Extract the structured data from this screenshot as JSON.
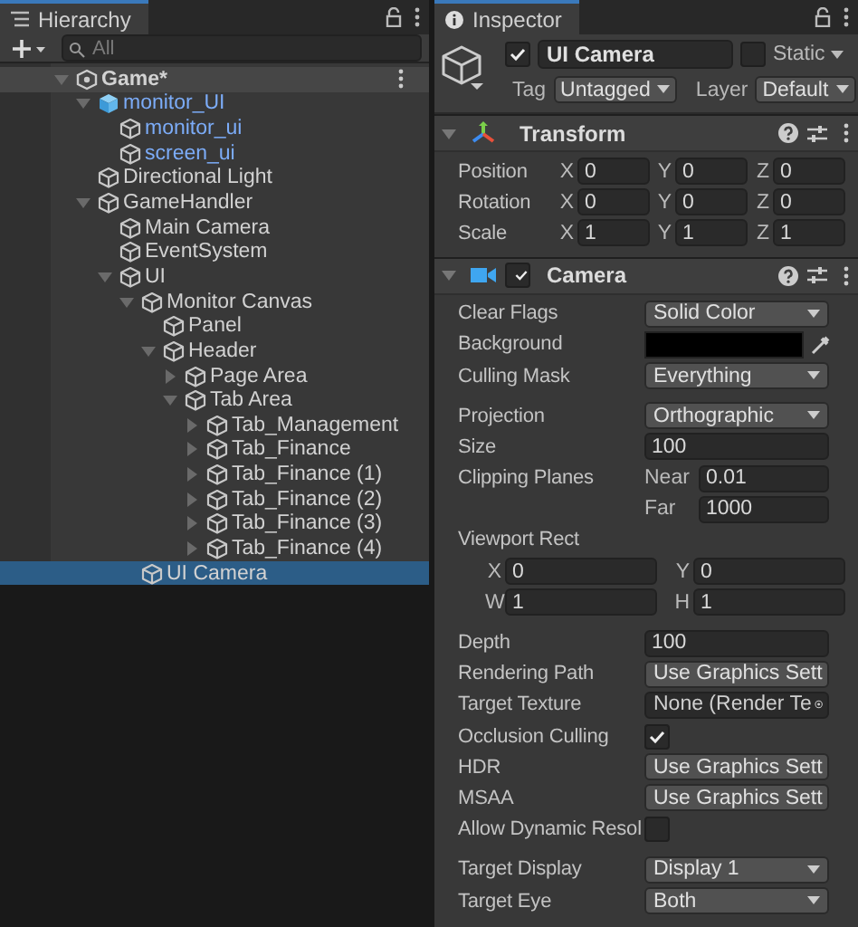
{
  "hierarchy": {
    "title": "Hierarchy",
    "search": {
      "placeholder": "All"
    },
    "items": [
      {
        "name": "Game*",
        "kind": "scene",
        "prefab": false,
        "expanded": true,
        "selected": false,
        "children": [
          {
            "name": "monitor_UI",
            "kind": "prefab",
            "prefab": true,
            "expanded": true,
            "selected": false,
            "children": [
              {
                "name": "monitor_ui",
                "kind": "object",
                "prefab": true,
                "selected": false
              },
              {
                "name": "screen_ui",
                "kind": "object",
                "prefab": true,
                "selected": false
              }
            ]
          },
          {
            "name": "Directional Light",
            "kind": "object",
            "prefab": false,
            "selected": false
          },
          {
            "name": "GameHandler",
            "kind": "object",
            "prefab": false,
            "expanded": true,
            "selected": false,
            "children": [
              {
                "name": "Main Camera",
                "kind": "object",
                "prefab": false,
                "selected": false
              },
              {
                "name": "EventSystem",
                "kind": "object",
                "prefab": false,
                "selected": false
              },
              {
                "name": "UI",
                "kind": "object",
                "prefab": false,
                "expanded": true,
                "selected": false,
                "children": [
                  {
                    "name": "Monitor Canvas",
                    "kind": "object",
                    "prefab": false,
                    "expanded": true,
                    "selected": false,
                    "children": [
                      {
                        "name": "Panel",
                        "kind": "object",
                        "prefab": false,
                        "selected": false
                      },
                      {
                        "name": "Header",
                        "kind": "object",
                        "prefab": false,
                        "expanded": true,
                        "selected": false,
                        "children": [
                          {
                            "name": "Page Area",
                            "kind": "object",
                            "prefab": false,
                            "expanded": false,
                            "selected": false
                          },
                          {
                            "name": "Tab Area",
                            "kind": "object",
                            "prefab": false,
                            "expanded": true,
                            "selected": false,
                            "children": [
                              {
                                "name": "Tab_Management",
                                "kind": "object",
                                "prefab": false,
                                "expanded": false,
                                "selected": false
                              },
                              {
                                "name": "Tab_Finance",
                                "kind": "object",
                                "prefab": false,
                                "expanded": false,
                                "selected": false
                              },
                              {
                                "name": "Tab_Finance (1)",
                                "kind": "object",
                                "prefab": false,
                                "expanded": false,
                                "selected": false
                              },
                              {
                                "name": "Tab_Finance (2)",
                                "kind": "object",
                                "prefab": false,
                                "expanded": false,
                                "selected": false
                              },
                              {
                                "name": "Tab_Finance (3)",
                                "kind": "object",
                                "prefab": false,
                                "expanded": false,
                                "selected": false
                              },
                              {
                                "name": "Tab_Finance (4)",
                                "kind": "object",
                                "prefab": false,
                                "expanded": false,
                                "selected": false
                              }
                            ]
                          }
                        ]
                      }
                    ]
                  },
                  {
                    "name": "UI Camera",
                    "kind": "object",
                    "prefab": false,
                    "selected": true
                  }
                ]
              }
            ]
          }
        ]
      }
    ]
  },
  "inspector": {
    "title": "Inspector",
    "object": {
      "active": true,
      "name": "UI Camera",
      "static": false,
      "static_label": "Static",
      "tag_label": "Tag",
      "tag": "Untagged",
      "layer_label": "Layer",
      "layer": "Default"
    },
    "components": [
      {
        "kind": "transform",
        "title": "Transform",
        "expanded": true,
        "rows": [
          {
            "label": "Position",
            "values": [
              {
                "axis": "X",
                "value": "0"
              },
              {
                "axis": "Y",
                "value": "0"
              },
              {
                "axis": "Z",
                "value": "0"
              }
            ]
          },
          {
            "label": "Rotation",
            "values": [
              {
                "axis": "X",
                "value": "0"
              },
              {
                "axis": "Y",
                "value": "0"
              },
              {
                "axis": "Z",
                "value": "0"
              }
            ]
          },
          {
            "label": "Scale",
            "values": [
              {
                "axis": "X",
                "value": "1"
              },
              {
                "axis": "Y",
                "value": "1"
              },
              {
                "axis": "Z",
                "value": "1"
              }
            ]
          }
        ]
      },
      {
        "kind": "camera",
        "title": "Camera",
        "expanded": true,
        "enabled": true,
        "groups": [
          [
            {
              "kind": "dropdown",
              "label": "Clear Flags",
              "value": "Solid Color"
            },
            {
              "kind": "color",
              "label": "Background",
              "color": "#000000"
            },
            {
              "kind": "dropdown",
              "label": "Culling Mask",
              "value": "Everything"
            }
          ],
          [
            {
              "kind": "dropdown",
              "label": "Projection",
              "value": "Orthographic"
            },
            {
              "kind": "number",
              "label": "Size",
              "value": "100"
            },
            {
              "kind": "pair",
              "label": "Clipping Planes",
              "parts": [
                {
                  "label": "Near",
                  "value": "0.01"
                },
                {
                  "label": "Far",
                  "value": "1000"
                }
              ]
            },
            {
              "kind": "heading",
              "label": "Viewport Rect"
            },
            {
              "kind": "vec2",
              "parts": [
                {
                  "axis": "X",
                  "value": "0"
                },
                {
                  "axis": "Y",
                  "value": "0"
                }
              ]
            },
            {
              "kind": "vec2",
              "parts": [
                {
                  "axis": "W",
                  "value": "1"
                },
                {
                  "axis": "H",
                  "value": "1"
                }
              ]
            }
          ],
          [
            {
              "kind": "number",
              "label": "Depth",
              "value": "100"
            },
            {
              "kind": "dropdown",
              "label": "Rendering Path",
              "value": "Use Graphics Sett"
            },
            {
              "kind": "object",
              "label": "Target Texture",
              "value": "None (Render Te"
            },
            {
              "kind": "checkbox",
              "label": "Occlusion Culling",
              "checked": true
            },
            {
              "kind": "dropdown",
              "label": "HDR",
              "value": "Use Graphics Sett"
            },
            {
              "kind": "dropdown",
              "label": "MSAA",
              "value": "Use Graphics Sett"
            },
            {
              "kind": "checkbox",
              "label": "Allow Dynamic Resol",
              "checked": false
            }
          ],
          [
            {
              "kind": "dropdown",
              "label": "Target Display",
              "value": "Display 1"
            },
            {
              "kind": "dropdown",
              "label": "Target Eye",
              "value": "Both"
            }
          ]
        ]
      }
    ]
  }
}
